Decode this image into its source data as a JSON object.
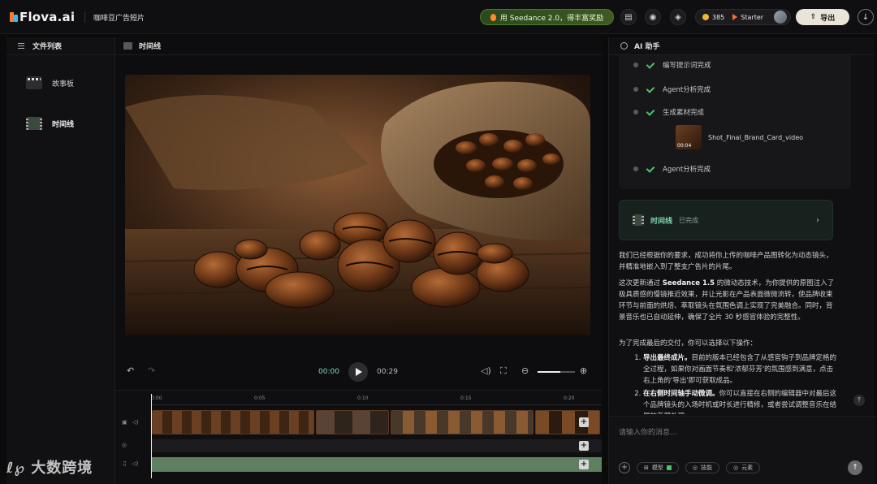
{
  "app": {
    "logo": "Flova.ai",
    "project_title": "咖啡豆广告短片"
  },
  "topbar": {
    "promo": "用 Seedance 2.0，得丰富奖励",
    "credits": "385",
    "plan": "Starter",
    "export_label": "导出"
  },
  "left_panel": {
    "title": "文件列表",
    "items": [
      {
        "label": "故事板"
      },
      {
        "label": "时间线"
      }
    ]
  },
  "center": {
    "title": "时间线",
    "current_time": "00:00",
    "total_time": "00:29",
    "zoom_level": 0.6,
    "ruler_ticks": [
      "0:00",
      "0:05",
      "0:10",
      "0:15",
      "0:20"
    ]
  },
  "ai_panel": {
    "title": "AI 助手",
    "steps": [
      {
        "label": "编写提示词完成"
      },
      {
        "label": "Agent分析完成"
      },
      {
        "label": "生成素材完成"
      },
      {
        "label": "Agent分析完成"
      }
    ],
    "asset": {
      "name": "Shot_Final_Brand_Card_video",
      "duration": "00:04"
    },
    "timeline_card": {
      "title": "时间线",
      "status": "已完成"
    },
    "message": {
      "p1": "我们已经根据你的要求，成功将你上传的咖啡产品图转化为动态镜头，并精准地嵌入到了整支广告片的片尾。",
      "p2_prefix": "这次更新通过 ",
      "p2_bold": "Seedance 1.5",
      "p2_rest": " 的微动态技术，为你提供的原图注入了极具质感的慢镜推近效果，并让光影在产品表面微微流转，使品牌收束环节与前面的烘焙、萃取镜头在氛围色调上实现了完美融合。同时，背景音乐也已自动延伸，确保了全片 30 秒感官体验的完整性。",
      "p3": "为了完成最后的交付，你可以选择以下操作：",
      "li1_bold": "导出最终成片。",
      "li1_rest": "目前的版本已经包含了从感官钩子到品牌定格的全过程，如果你对画面节奏和'浓郁芬芳'的氛围感到满意，点击右上角的'导出'即可获取成品。",
      "li2_bold": "在右侧时间轴手动微调。",
      "li2_rest": "你可以直接在右侧的编辑器中对最后这个品牌镜头的入场时机或时长进行精修，或者尝试调整音乐在结尾的渐弱处理。"
    },
    "input_placeholder": "请输入你的消息...",
    "chips": [
      "模型",
      "技能",
      "元素"
    ]
  },
  "watermark": "大数跨境"
}
